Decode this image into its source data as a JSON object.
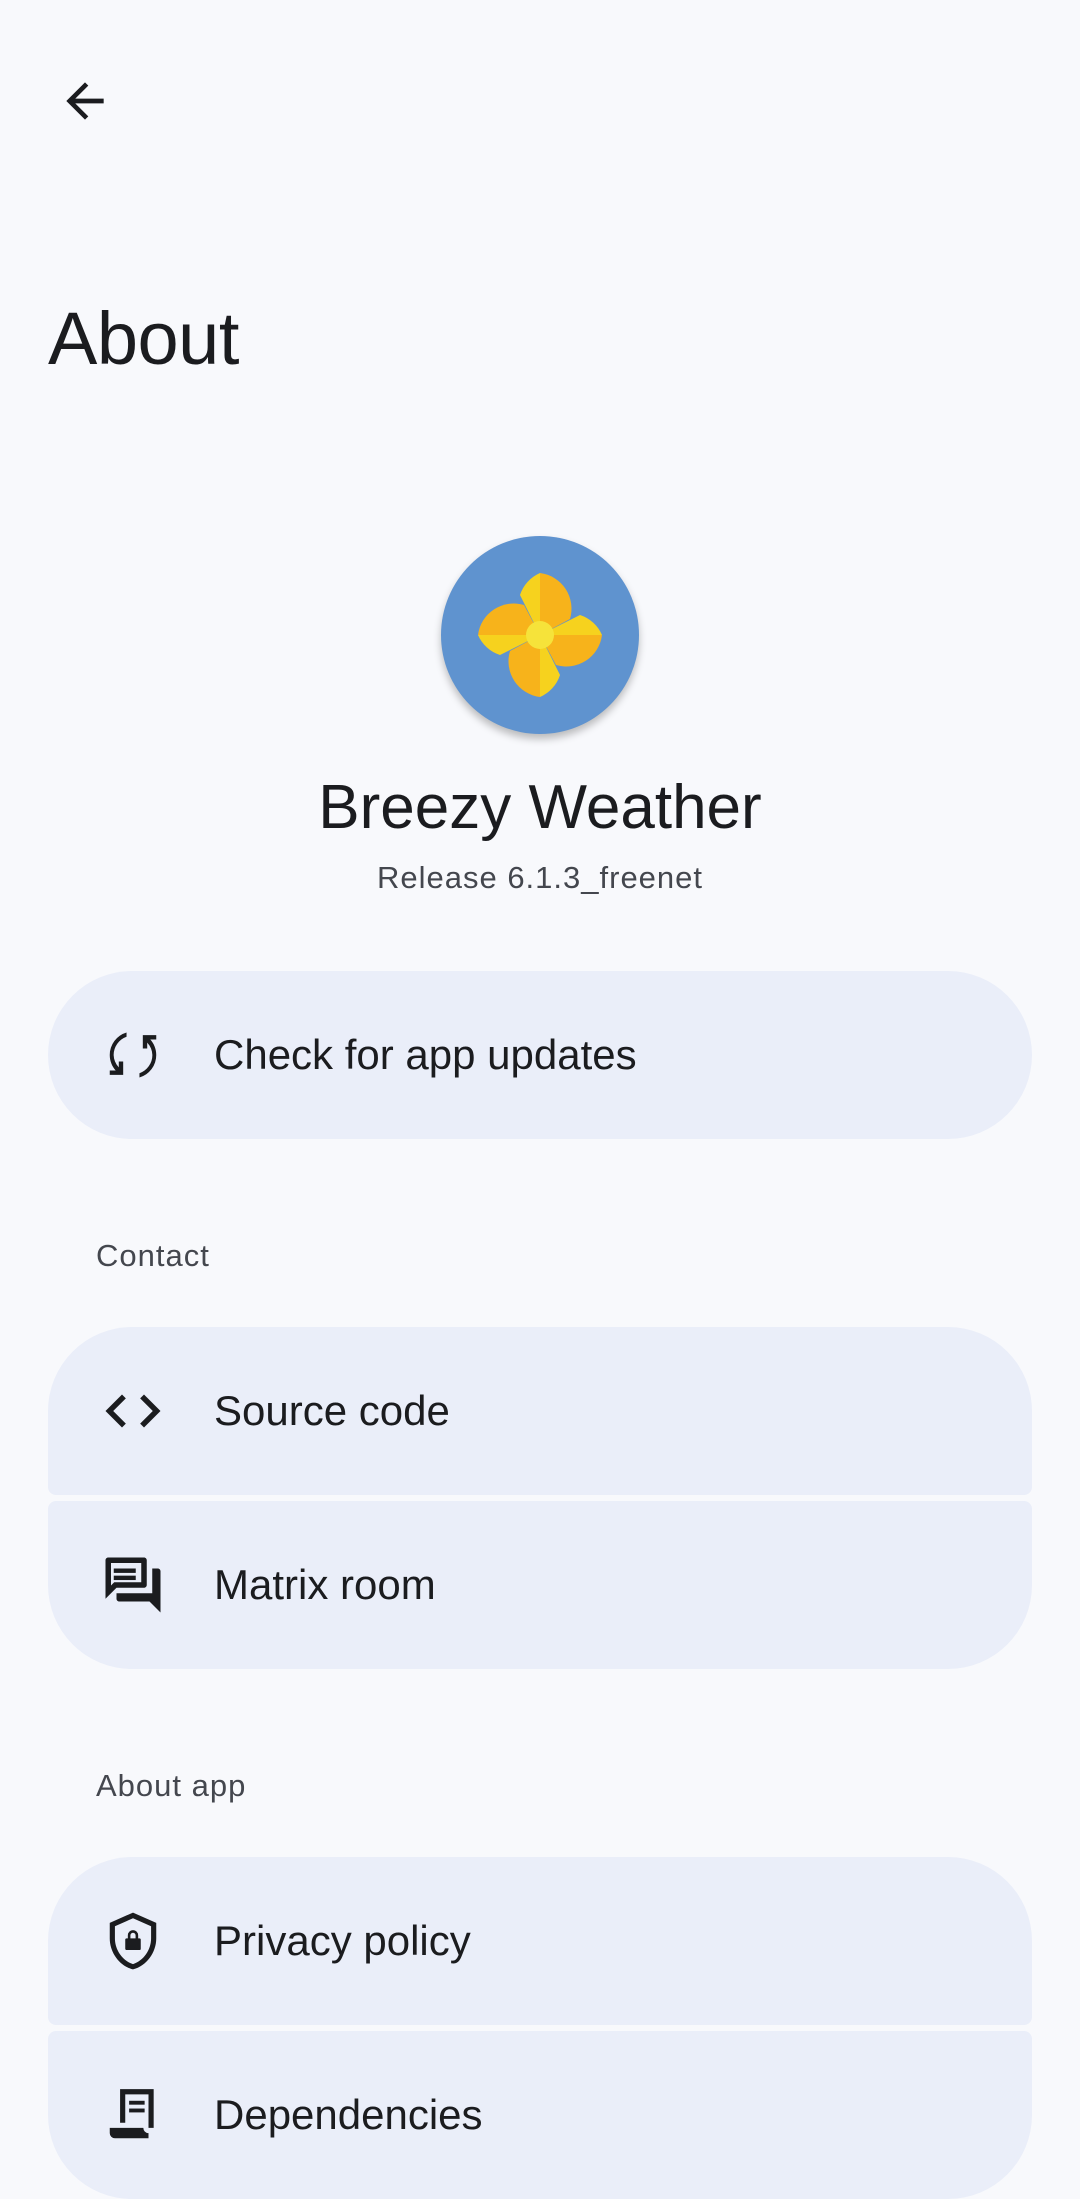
{
  "header": {
    "back_icon": "arrow-back-icon",
    "title": "About"
  },
  "app": {
    "logo_icon": "breezy-weather-logo",
    "name": "Breezy Weather",
    "version": "Release 6.1.3_freenet"
  },
  "updates": {
    "icon": "update-icon",
    "label": "Check for app updates"
  },
  "contact": {
    "header": "Contact",
    "items": [
      {
        "icon": "code-icon",
        "label": "Source code"
      },
      {
        "icon": "forum-icon",
        "label": "Matrix room"
      }
    ]
  },
  "about_app": {
    "header": "About app",
    "items": [
      {
        "icon": "privacy-shield-icon",
        "label": "Privacy policy"
      },
      {
        "icon": "dependencies-icon",
        "label": "Dependencies"
      }
    ]
  },
  "colors": {
    "background": "#F8F9FC",
    "card": "#EAEEF9",
    "logo_background": "#5F93CF",
    "logo_yellow": "#F6D21E",
    "logo_orange": "#F7B31B"
  }
}
